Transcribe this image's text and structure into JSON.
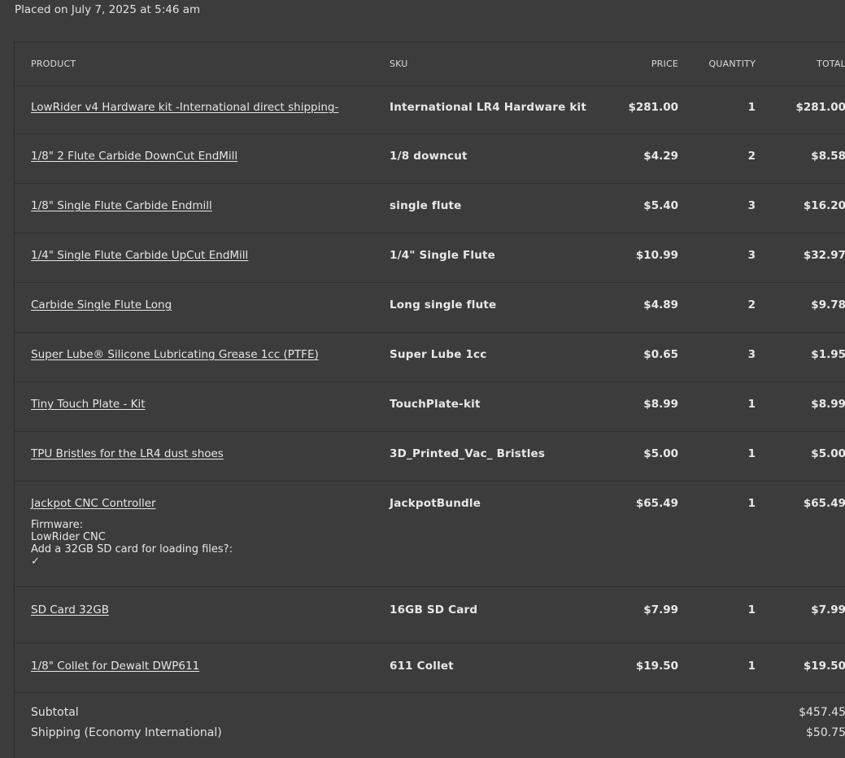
{
  "order": {
    "placed": "Placed on July 7, 2025 at 5:46 am"
  },
  "table": {
    "headers": {
      "product": "PRODUCT",
      "sku": "SKU",
      "price": "PRICE",
      "quantity": "QUANTITY",
      "total": "TOTAL"
    },
    "rows": [
      {
        "product": "LowRider v4 Hardware kit -International direct shipping-",
        "sku": "International LR4 Hardware kit",
        "price": "$281.00",
        "quantity": "1",
        "total": "$281.00"
      },
      {
        "product": "1/8\" 2 Flute Carbide DownCut EndMill",
        "sku": "1/8 downcut",
        "price": "$4.29",
        "quantity": "2",
        "total": "$8.58"
      },
      {
        "product": "1/8\" Single Flute Carbide Endmill",
        "sku": "single flute",
        "price": "$5.40",
        "quantity": "3",
        "total": "$16.20"
      },
      {
        "product": "1/4\" Single Flute Carbide UpCut EndMill",
        "sku": "1/4\" Single Flute",
        "price": "$10.99",
        "quantity": "3",
        "total": "$32.97"
      },
      {
        "product": "Carbide Single Flute Long",
        "sku": "Long single flute",
        "price": "$4.89",
        "quantity": "2",
        "total": "$9.78"
      },
      {
        "product": "Super Lube® Silicone Lubricating Grease 1cc (PTFE)",
        "sku": "Super Lube 1cc",
        "price": "$0.65",
        "quantity": "3",
        "total": "$1.95"
      },
      {
        "product": "Tiny Touch Plate - Kit",
        "sku": "TouchPlate-kit",
        "price": "$8.99",
        "quantity": "1",
        "total": "$8.99"
      },
      {
        "product": "TPU Bristles for the LR4 dust shoes",
        "sku": "3D_Printed_Vac_ Bristles",
        "price": "$5.00",
        "quantity": "1",
        "total": "$5.00"
      },
      {
        "product": "Jackpot CNC Controller",
        "sku": "JackpotBundle",
        "price": "$65.49",
        "quantity": "1",
        "total": "$65.49",
        "meta": [
          "Firmware:",
          "LowRider CNC",
          "Add a 32GB SD card for loading files?:",
          "✓"
        ]
      },
      {
        "product": "SD Card 32GB",
        "sku": "16GB SD Card",
        "price": "$7.99",
        "quantity": "1",
        "total": "$7.99"
      },
      {
        "product": "1/8\" Collet for Dewalt DWP611",
        "sku": "611 Collet",
        "price": "$19.50",
        "quantity": "1",
        "total": "$19.50"
      }
    ]
  },
  "totals": {
    "subtotal_label": "Subtotal",
    "subtotal_value": "$457.45",
    "shipping_label": "Shipping (Economy International)",
    "shipping_value": "$50.75"
  }
}
